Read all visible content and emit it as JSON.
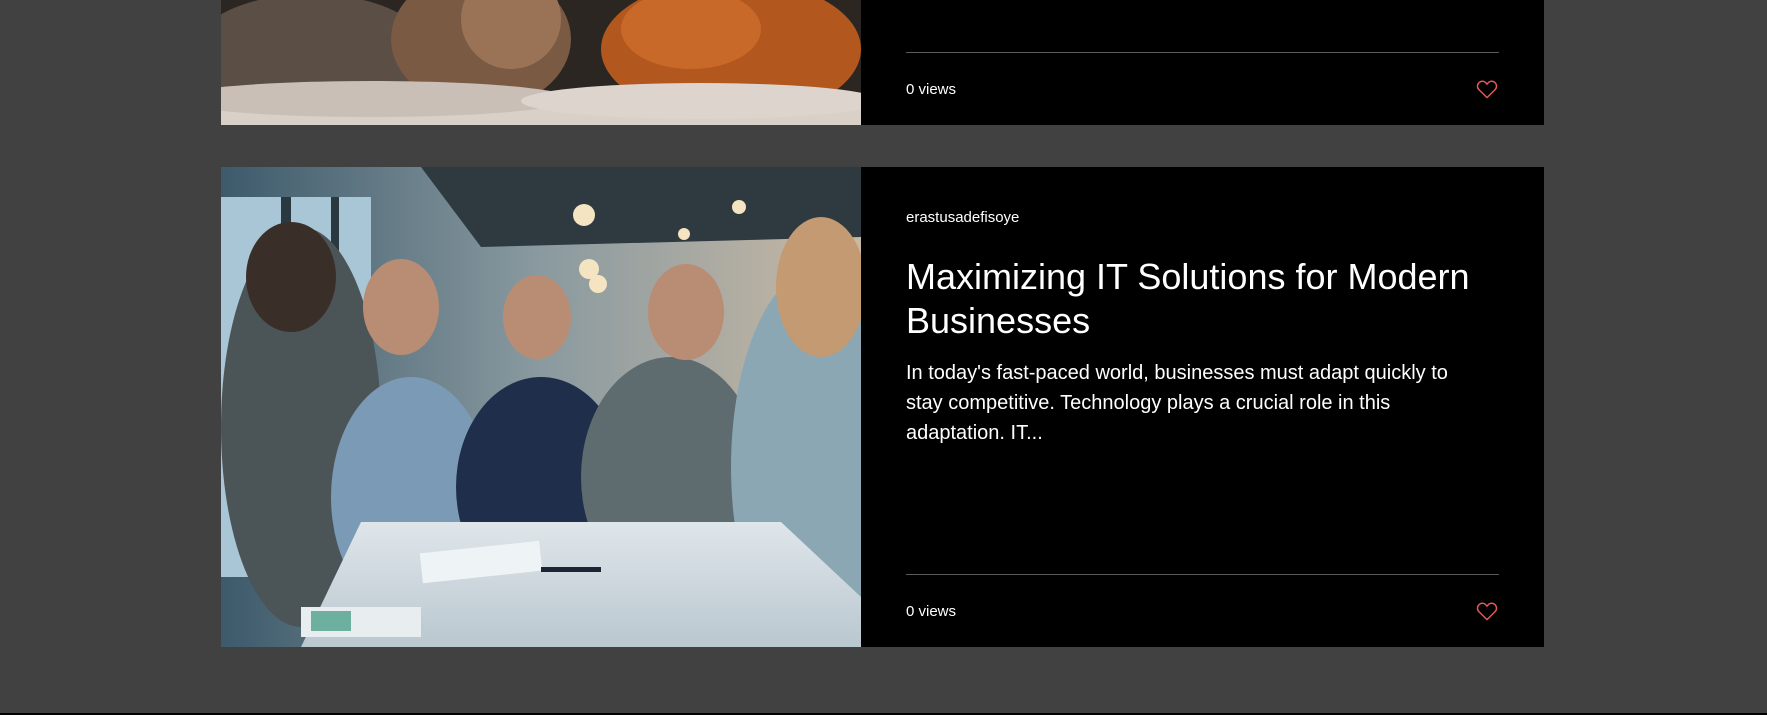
{
  "posts": [
    {
      "views": "0 views",
      "image": "photo-people-on-bed"
    },
    {
      "author": "erastusadefisoye",
      "title": "Maximizing IT Solutions for Modern Businesses",
      "excerpt": "In today's fast-paced world, businesses must adapt quickly to stay competitive. Technology plays a crucial role in this adaptation. IT...",
      "views": "0 views",
      "image": "photo-office-meeting"
    }
  ],
  "colors": {
    "page_background": "#414141",
    "card_background": "#000000",
    "text": "#ffffff",
    "like_icon": "#e35a5a",
    "divider": "#5a5a5a"
  },
  "icons": {
    "like": "heart-outline-icon"
  }
}
